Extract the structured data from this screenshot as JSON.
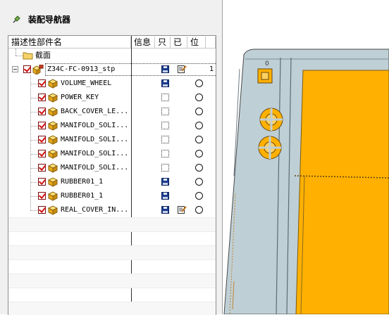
{
  "panel": {
    "title": "装配导航器"
  },
  "columns": {
    "name": "描述性部件名",
    "info": "信息",
    "readonly": "只",
    "modified": "已",
    "position": "位"
  },
  "tree": {
    "section_node": "截面",
    "root": {
      "name": "Z34C-FC-0913_stp",
      "count": "1"
    },
    "children": [
      {
        "name": "VOLUME_WHEEL",
        "readonly": "saved",
        "modified": "",
        "position": "circle"
      },
      {
        "name": "POWER_KEY",
        "readonly": "unsaved",
        "modified": "",
        "position": "circle"
      },
      {
        "name": "BACK_COVER_LE...",
        "readonly": "unsaved",
        "modified": "",
        "position": "circle"
      },
      {
        "name": "MANIFOLD_SOLI...",
        "readonly": "unsaved",
        "modified": "",
        "position": "circle"
      },
      {
        "name": "MANIFOLD_SOLI...",
        "readonly": "unsaved",
        "modified": "",
        "position": "circle"
      },
      {
        "name": "MANIFOLD_SOLI...",
        "readonly": "unsaved",
        "modified": "",
        "position": "circle"
      },
      {
        "name": "MANIFOLD_SOLI...",
        "readonly": "unsaved",
        "modified": "",
        "position": "circle"
      },
      {
        "name": "RUBBER01_1",
        "readonly": "saved",
        "modified": "",
        "position": "circle"
      },
      {
        "name": "RUBBER01_1",
        "readonly": "saved",
        "modified": "",
        "position": "circle"
      },
      {
        "name": "REAL_COVER_IN...",
        "readonly": "saved",
        "modified": "edited",
        "position": "circle"
      }
    ]
  },
  "colors": {
    "part_body": "#ffb000",
    "part_frame": "#bfcfd6",
    "check": "#d01010"
  },
  "icons": {
    "panel": "pin-icon",
    "part": "component-cube-icon",
    "assembly": "assembly-icon",
    "folder": "folder-icon",
    "save": "save-disk-icon",
    "edit": "edit-note-icon"
  }
}
